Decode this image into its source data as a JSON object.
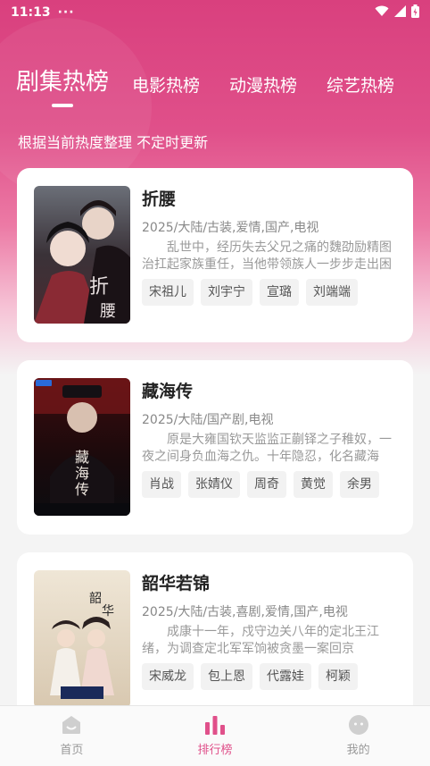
{
  "status_bar": {
    "time": "11:13",
    "more": "···"
  },
  "tabs": [
    {
      "label": "剧集热榜",
      "active": true
    },
    {
      "label": "电影热榜",
      "active": false
    },
    {
      "label": "动漫热榜",
      "active": false
    },
    {
      "label": "综艺热榜",
      "active": false
    }
  ],
  "subtitle": "根据当前热度整理 不定时更新",
  "shows": [
    {
      "title": "折腰",
      "meta": "2025/大陆/古装,爱情,国产,电视",
      "desc": "乱世中，经历失去父兄之痛的魏劭励精图治扛起家族重任，当他带领族人一步步走出困境",
      "actors": [
        "宋祖儿",
        "刘宇宁",
        "宣璐",
        "刘端端"
      ]
    },
    {
      "title": "藏海传",
      "meta": "2025/大陆/国产剧,电视",
      "desc": "原是大雍国钦天监监正蒯铎之子稚奴，一夜之间身负血海之仇。十年隐忍，化名藏海",
      "actors": [
        "肖战",
        "张婧仪",
        "周奇",
        "黄觉",
        "余男"
      ]
    },
    {
      "title": "韶华若锦",
      "meta": "2025/大陆/古装,喜剧,爱情,国产,电视",
      "desc": "成康十一年，戍守边关八年的定北王江绪，为调查定北军军饷被贪墨一案回京",
      "actors": [
        "宋威龙",
        "包上恩",
        "代露娃",
        "柯颖"
      ]
    }
  ],
  "bottom_nav": [
    {
      "label": "首页",
      "icon": "home-icon",
      "active": false
    },
    {
      "label": "排行榜",
      "icon": "ranking-icon",
      "active": true
    },
    {
      "label": "我的",
      "icon": "profile-icon",
      "active": false
    }
  ],
  "colors": {
    "accent": "#e0508a",
    "hero": "#d9407e"
  }
}
